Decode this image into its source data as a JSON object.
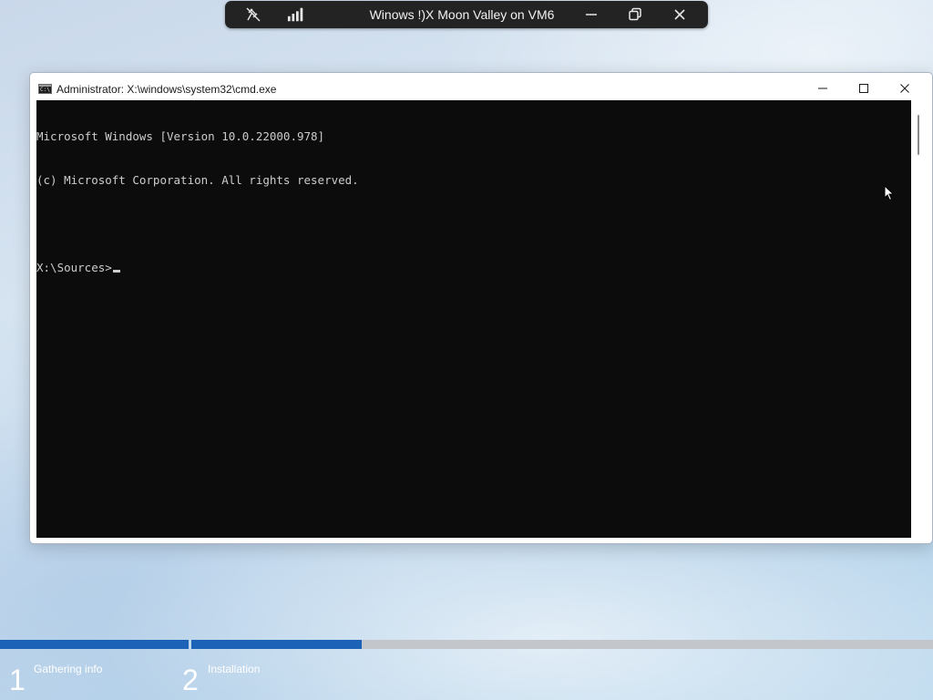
{
  "remote_bar": {
    "title": "Winows !)X Moon Valley on VM6",
    "icons": [
      "pin-icon",
      "signal-icon",
      "minimize-icon",
      "restore-icon",
      "close-icon"
    ]
  },
  "cmd": {
    "title": "Administrator: X:\\windows\\system32\\cmd.exe",
    "app_icon_text": "C:\\",
    "lines": [
      "Microsoft Windows [Version 10.0.22000.978]",
      "(c) Microsoft Corporation. All rights reserved.",
      "",
      "X:\\Sources>"
    ],
    "colors": {
      "background": "#0c0c0c",
      "text": "#cccccc"
    }
  },
  "setup_progress": {
    "steps": [
      {
        "number": "1",
        "label": "Gathering info",
        "progress": 1.0
      },
      {
        "number": "2",
        "label": "Installation",
        "progress": 0.23
      }
    ],
    "accent_color": "#1c63b8"
  }
}
